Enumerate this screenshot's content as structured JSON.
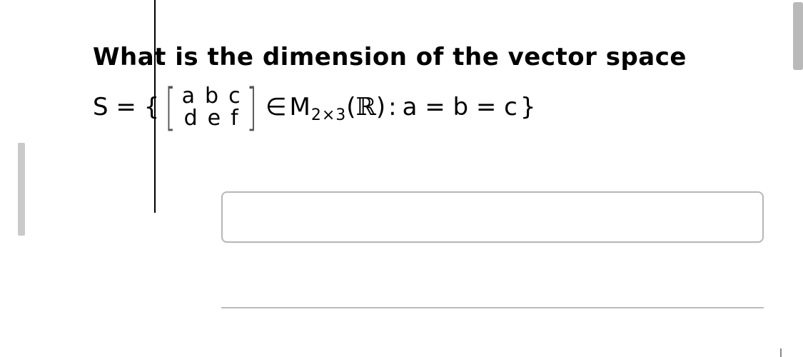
{
  "question": {
    "prompt": "What is the dimension of the vector space",
    "expr": {
      "lhs": "S = {",
      "matrix": {
        "row1": {
          "a": "a",
          "b": "b",
          "c": "c"
        },
        "row2": {
          "d": "d",
          "e": "e",
          "f": "f"
        }
      },
      "elem": "∈",
      "mspace_sym": "M",
      "dims": "2×3",
      "lparen": "(",
      "field": "ℝ",
      "rparen": ")",
      "colon": ":",
      "cond": "a = b = c",
      "rbrace": "}"
    }
  },
  "answer": {
    "value": "",
    "placeholder": ""
  }
}
